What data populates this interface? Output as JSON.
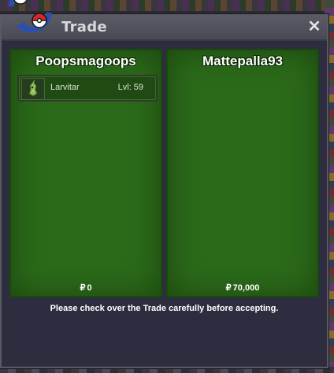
{
  "window": {
    "title": "Trade",
    "close_label": "✕",
    "icon": "trade-swap-pokeballs-icon"
  },
  "left_panel": {
    "trainer_name": "Poopsmagoops",
    "pokemon": [
      {
        "name": "Larvitar",
        "level": "Lvl: 59",
        "icon": "larvitar-sprite-icon"
      }
    ],
    "currency_symbol": "₽",
    "money": "0"
  },
  "right_panel": {
    "trainer_name": "Mattepalla93",
    "currency_symbol": "₽",
    "money": "70,000"
  },
  "footer": {
    "message": "Please check over the Trade carefully before accepting."
  },
  "colors": {
    "panel_green": "#2b6a19",
    "window_bg": "#2e2d40",
    "titlebar": "#55555f"
  }
}
